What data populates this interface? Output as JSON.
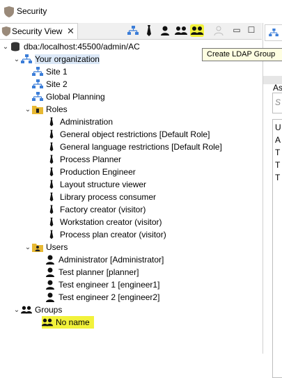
{
  "window": {
    "title": "Security"
  },
  "tab": {
    "label": "Security View",
    "close": "✕"
  },
  "toolbar": {
    "tools": [
      {
        "name": "create-site-button",
        "icon": "org-icon"
      },
      {
        "name": "create-role-button",
        "icon": "tie-icon"
      },
      {
        "name": "create-user-button",
        "icon": "user-icon"
      },
      {
        "name": "create-group-button",
        "icon": "group-icon"
      },
      {
        "name": "create-ldap-group-button",
        "icon": "group-icon",
        "highlighted": true
      },
      {
        "name": "disabled-user-button",
        "icon": "user-outline-icon"
      }
    ],
    "minimize": "▭",
    "maximize": "☐"
  },
  "tooltip": {
    "text": "Create LDAP Group"
  },
  "right_pane": {
    "label_as": "As",
    "label_s": "S",
    "list_letters": [
      "U",
      "A",
      "T",
      "T",
      "T"
    ]
  },
  "tree": {
    "connection": "dba:/localhost:45500/admin/AC",
    "organization": "Your organization",
    "sites": [
      "Site 1",
      "Site 2",
      "Global Planning"
    ],
    "roles_label": "Roles",
    "roles": [
      "Administration",
      "General object restrictions [Default Role]",
      "General language restrictions [Default Role]",
      "Process Planner",
      "Production Engineer",
      "Layout structure viewer",
      "Library process consumer",
      "Factory creator (visitor)",
      "Workstation creator (visitor)",
      "Process plan creator (visitor)"
    ],
    "users_label": "Users",
    "users": [
      "Administrator [Administrator]",
      "Test planner [planner]",
      "Test engineer 1 [engineer1]",
      "Test engineer 2 [engineer2]"
    ],
    "groups_label": "Groups",
    "groups": [
      "No name"
    ]
  },
  "colors": {
    "highlight": "#f2f23b",
    "selection": "#dbe8f7",
    "org_icon": "#3b7dd8",
    "folder": "#e7b832"
  }
}
